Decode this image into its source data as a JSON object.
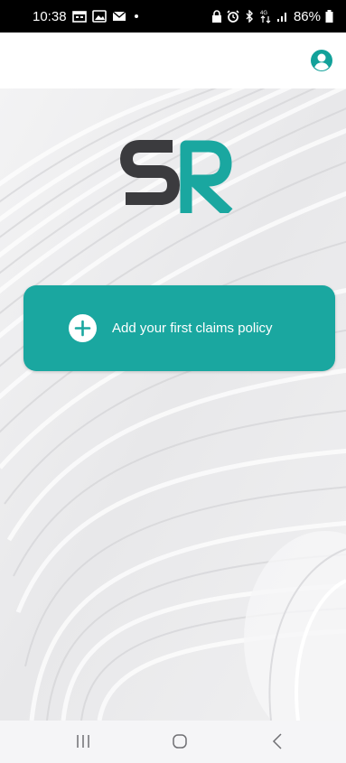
{
  "status_bar": {
    "time": "10:38",
    "notification_icons": [
      "calendar-icon",
      "photo-message-icon",
      "email-icon",
      "dot-icon"
    ],
    "system_icons": [
      "lock-icon",
      "alarm-icon",
      "bluetooth-icon",
      "data-arrows-icon",
      "signal-icon"
    ],
    "network_label": "4G",
    "battery": "86%"
  },
  "app_bar": {
    "account_icon": "account-circle-icon"
  },
  "logo": {
    "letter_1": "S",
    "letter_2": "R",
    "colors": {
      "s": "#3b3b3e",
      "r": "#1aa7a0"
    }
  },
  "add_policy": {
    "label": "Add your first claims policy",
    "icon": "plus-circle-icon",
    "color": "#1aa7a0"
  },
  "nav_bar": {
    "buttons": [
      "recent-apps-icon",
      "home-icon",
      "back-icon"
    ]
  },
  "colors": {
    "accent": "#1aa7a0",
    "icon_accent": "#12a19a"
  }
}
